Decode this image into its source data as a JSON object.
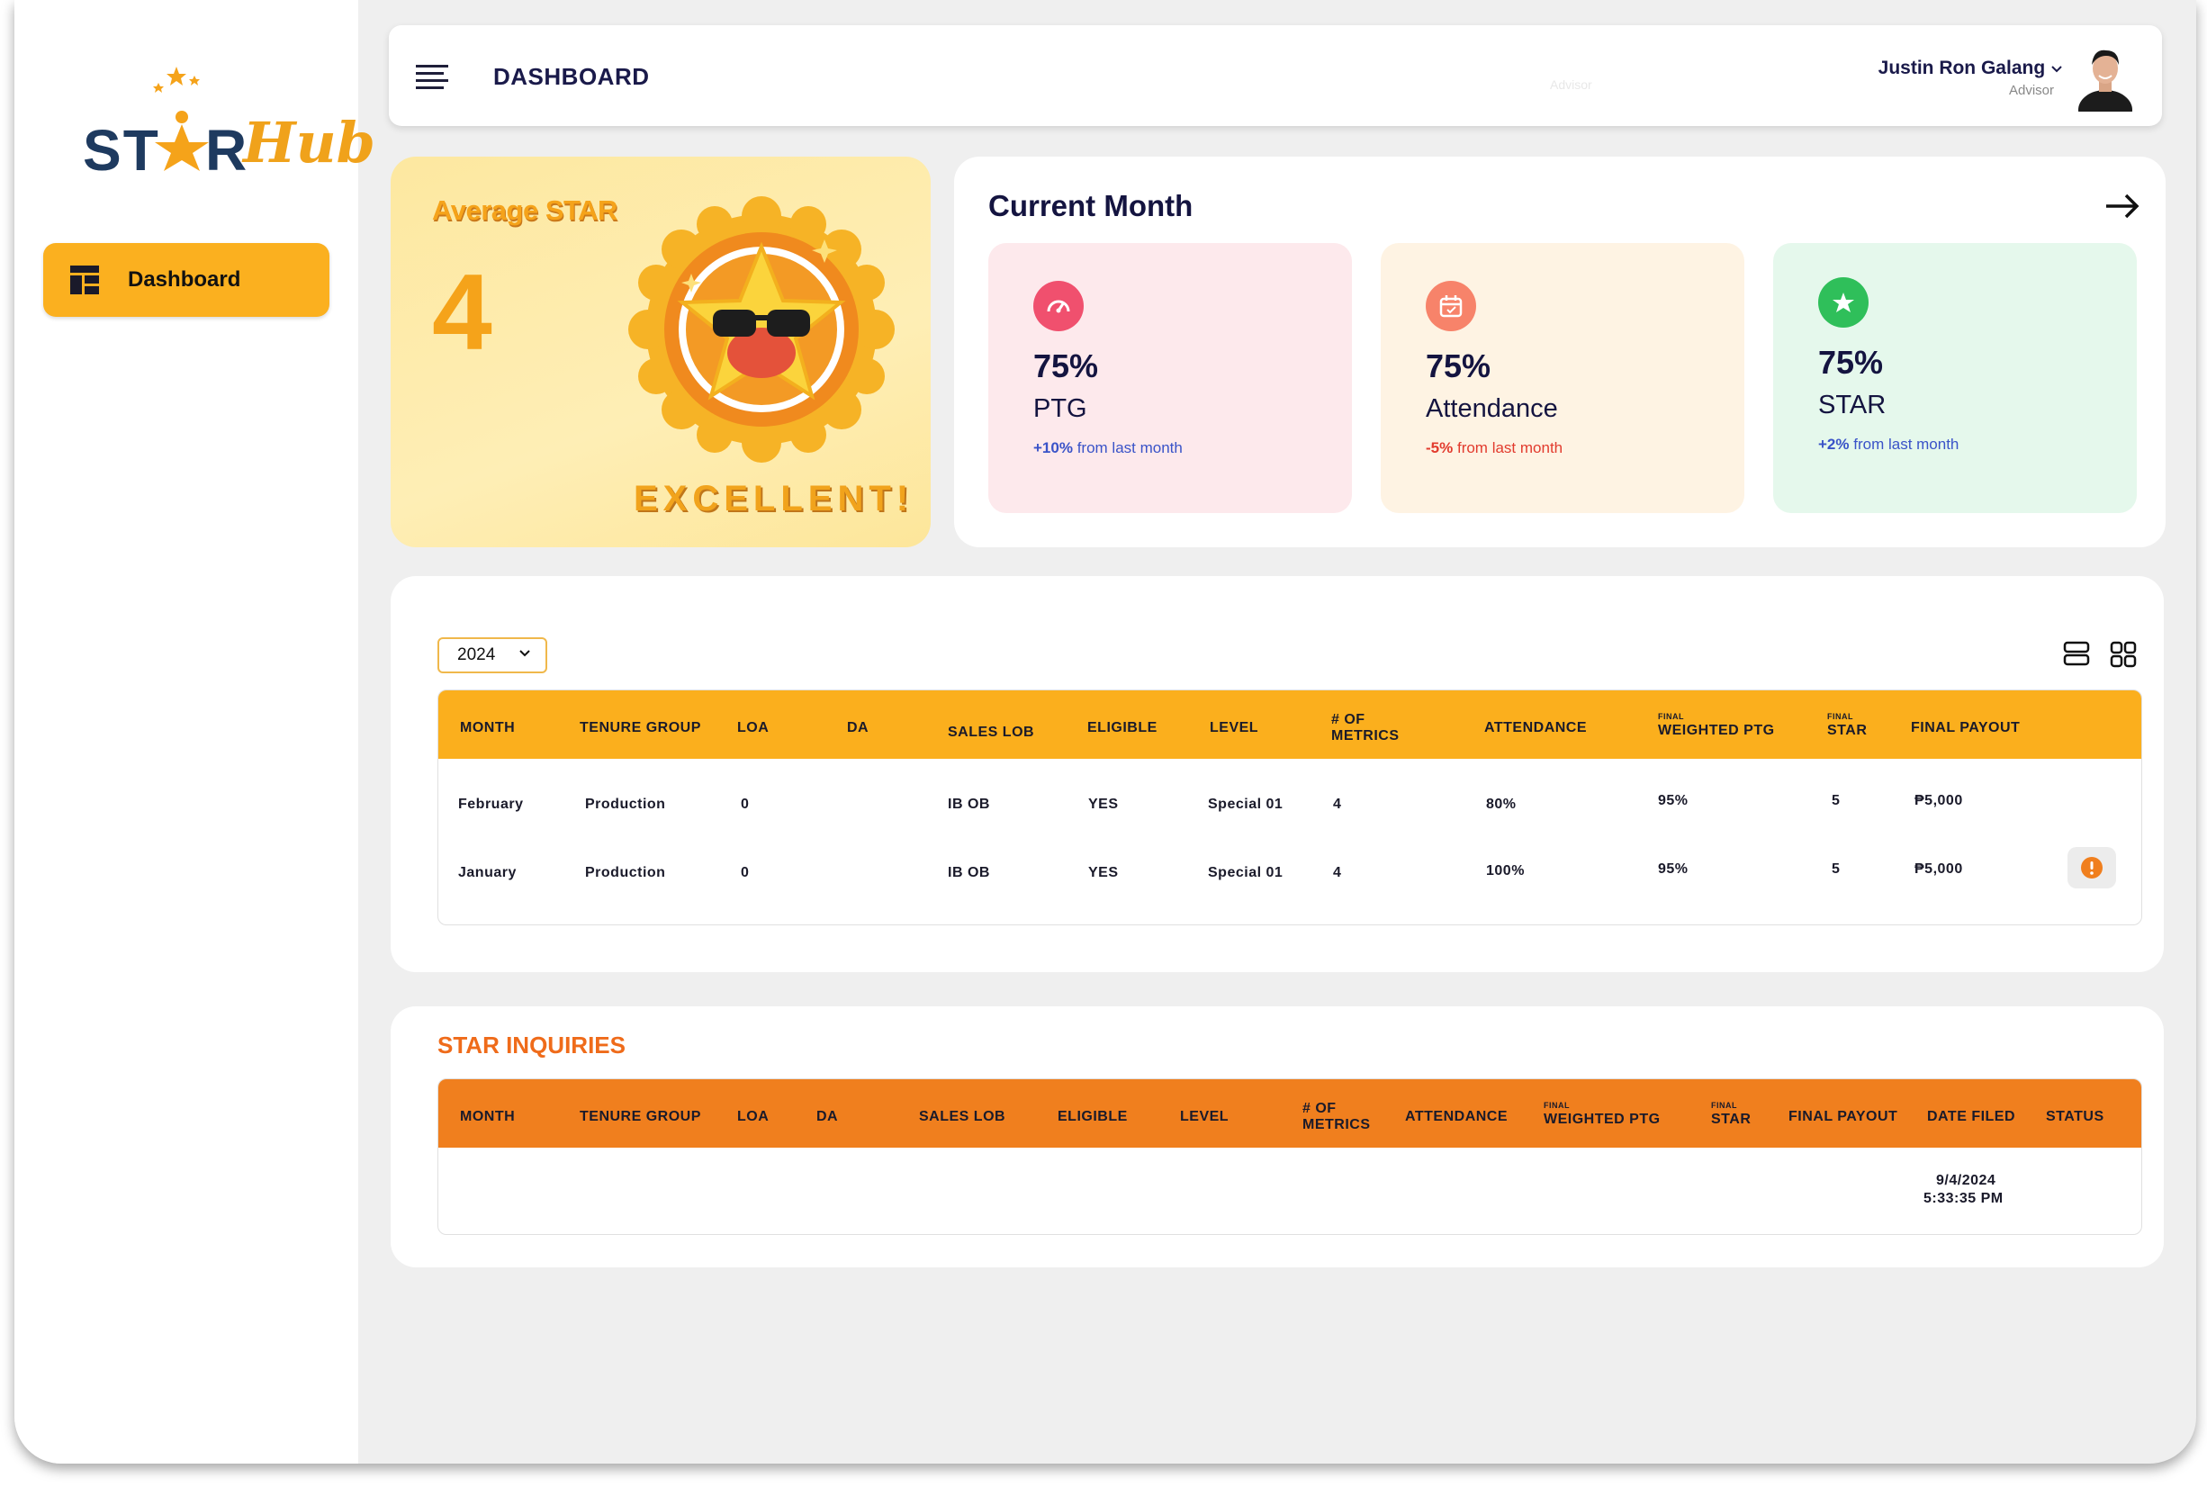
{
  "app": {
    "logo_star": "ST",
    "logo_r": "R",
    "logo_hub": "Hub",
    "accent_color": "#fbb01f",
    "inquiry_color": "#f07f1e"
  },
  "sidebar": {
    "items": [
      {
        "label": "Dashboard",
        "icon": "dashboard-icon",
        "active": true
      }
    ]
  },
  "header": {
    "title": "DASHBOARD",
    "faint_text": "Advisor",
    "user_name": "Justin Ron Galang",
    "user_role": "Advisor"
  },
  "average_star": {
    "title": "Average STAR",
    "value": "4",
    "rating": "EXCELLENT!"
  },
  "current_month": {
    "title": "Current Month",
    "stats": [
      {
        "value": "75%",
        "label": "PTG",
        "change": "+10%",
        "change_text": "from last month",
        "icon": "speedometer-icon",
        "bg": "#fde9ec",
        "icon_bg": "#f0506e",
        "change_color": "#3a53c8"
      },
      {
        "value": "75%",
        "label": "Attendance",
        "change": "-5%",
        "change_text": "from last month",
        "icon": "calendar-icon",
        "bg": "#fef3e3",
        "icon_bg": "#f7836a",
        "change_color": "#e23b2e"
      },
      {
        "value": "75%",
        "label": "STAR",
        "change": "+2%",
        "change_text": "from last month",
        "icon": "star-icon",
        "bg": "#e5f8ec",
        "icon_bg": "#2fbf5a",
        "change_color": "#3a53c8"
      }
    ]
  },
  "payout_table": {
    "year": "2024",
    "columns": {
      "month": "MONTH",
      "tenure": "TENURE GROUP",
      "loa": "LOA",
      "da": "DA",
      "sales_lob": "SALES LOB",
      "eligible": "ELIGIBLE",
      "level": "LEVEL",
      "metrics_1": "# OF",
      "metrics_2": "METRICS",
      "attendance": "ATTENDANCE",
      "wptg_small": "FINAL",
      "wptg": "WEIGHTED PTG",
      "star_small": "FINAL",
      "star": "STAR",
      "payout": "FINAL PAYOUT"
    },
    "rows": [
      {
        "month": "February",
        "tenure": "Production",
        "loa": "0",
        "da": "",
        "sales_lob": "IB OB",
        "eligible": "YES",
        "level": "Special 01",
        "metrics": "4",
        "attendance": "80%",
        "wptg": "95%",
        "star": "5",
        "payout": "₱5,000"
      },
      {
        "month": "January",
        "tenure": "Production",
        "loa": "0",
        "da": "",
        "sales_lob": "IB OB",
        "eligible": "YES",
        "level": "Special 01",
        "metrics": "4",
        "attendance": "100%",
        "wptg": "95%",
        "star": "5",
        "payout": "₱5,000"
      }
    ]
  },
  "inquiries": {
    "title": "STAR INQUIRIES",
    "columns": {
      "month": "MONTH",
      "tenure": "TENURE GROUP",
      "loa": "LOA",
      "da": "DA",
      "sales_lob": "SALES LOB",
      "eligible": "ELIGIBLE",
      "level": "LEVEL",
      "metrics_1": "# OF",
      "metrics_2": "METRICS",
      "attendance": "ATTENDANCE",
      "wptg_small": "FINAL",
      "wptg": "WEIGHTED PTG",
      "star_small": "FINAL",
      "star": "STAR",
      "payout": "FINAL PAYOUT",
      "date_filed": "DATE FILED",
      "status": "STATUS"
    },
    "rows": [
      {
        "date_filed_1": "9/4/2024",
        "date_filed_2": "5:33:35 PM"
      }
    ]
  }
}
